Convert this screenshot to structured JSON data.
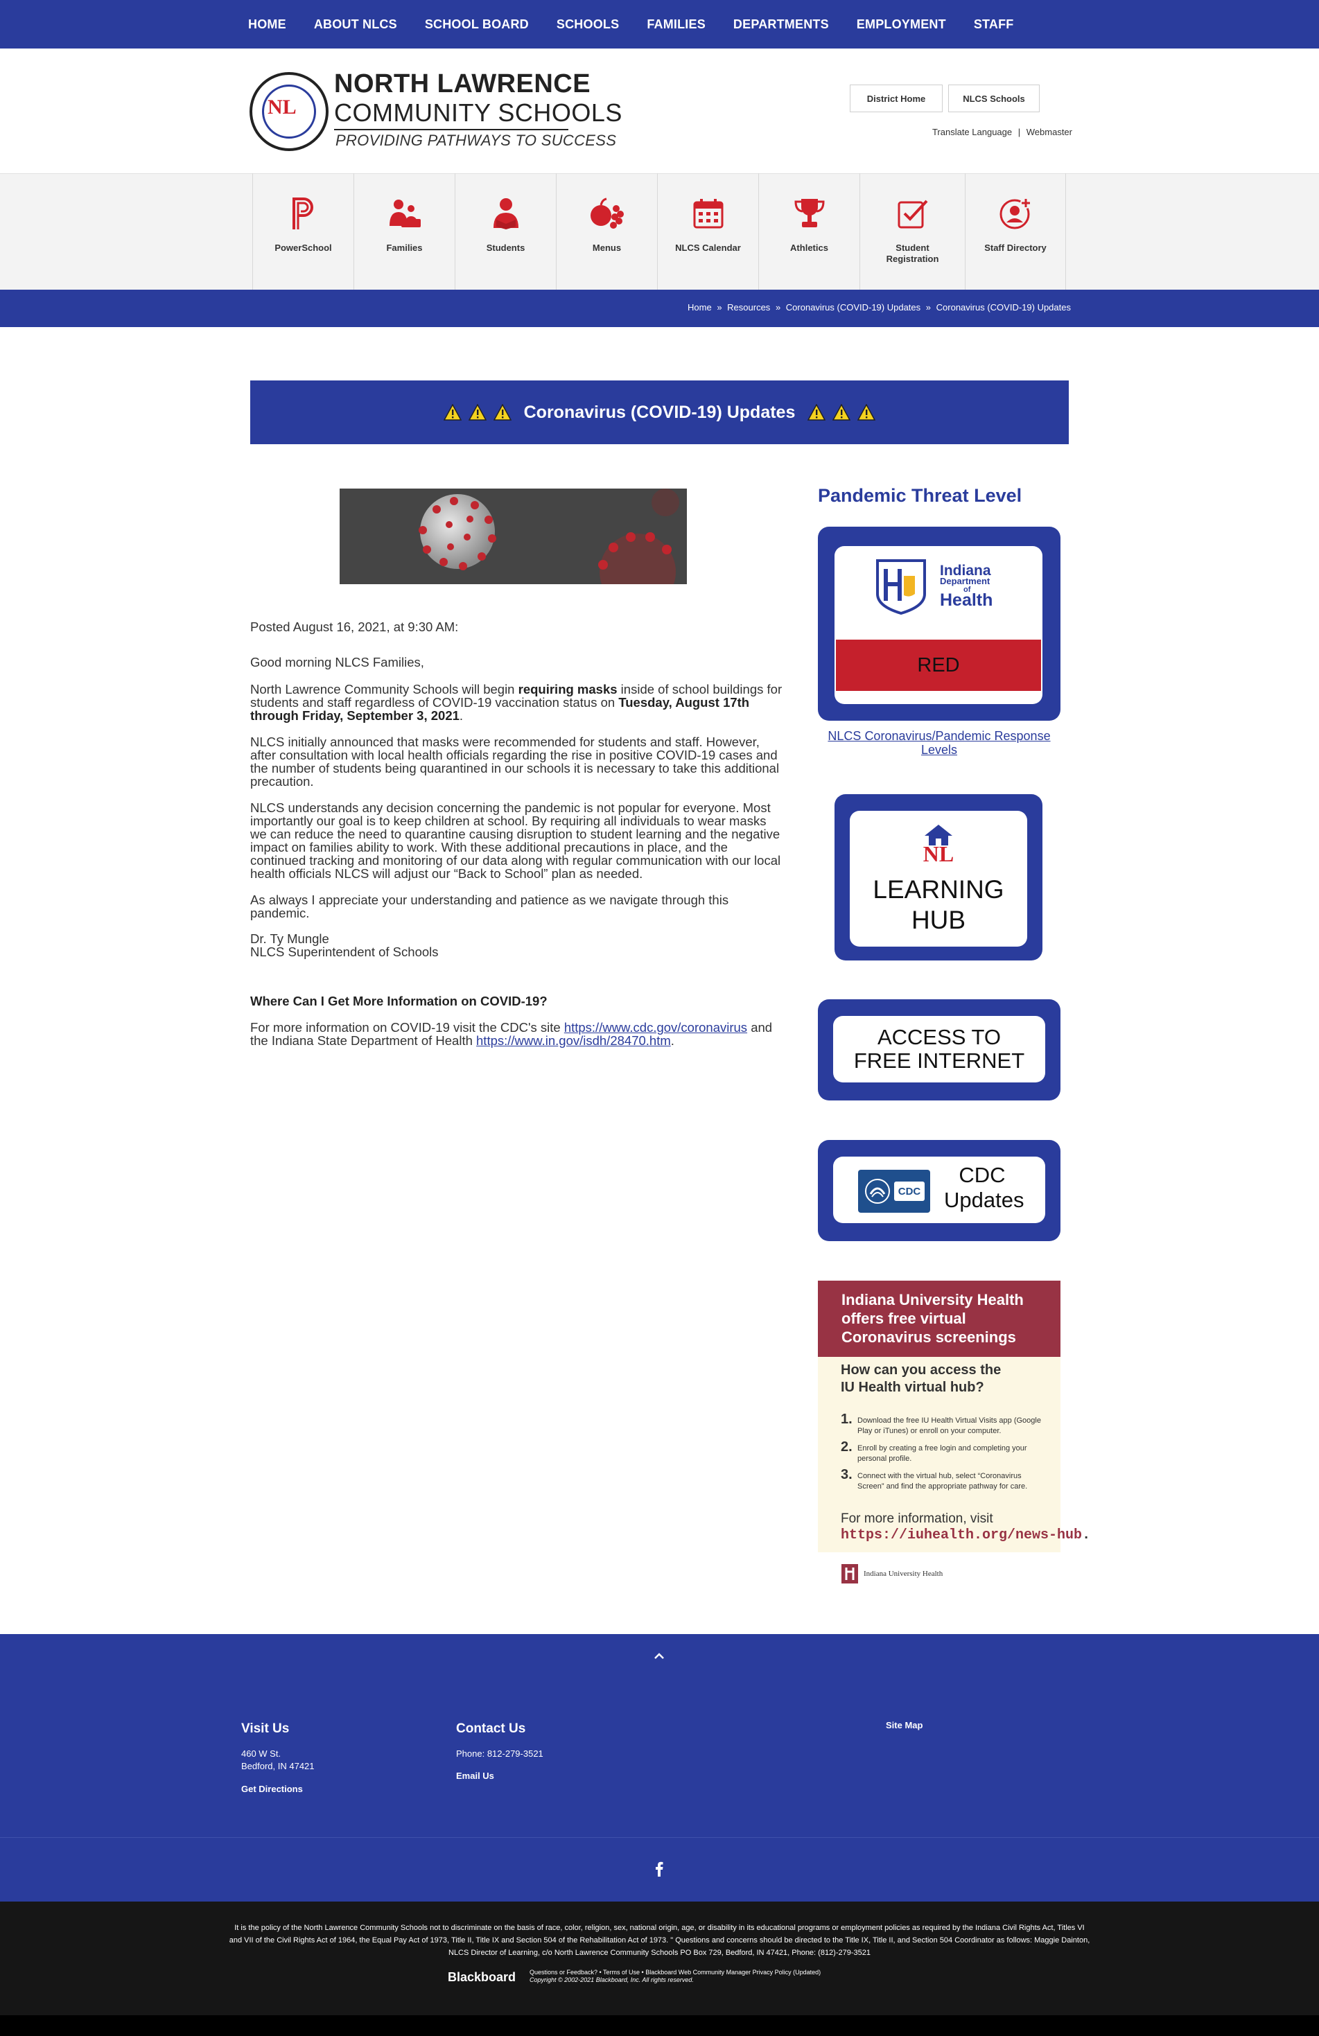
{
  "topnav": {
    "items": [
      "HOME",
      "ABOUT NLCS",
      "SCHOOL BOARD",
      "SCHOOLS",
      "FAMILIES",
      "DEPARTMENTS",
      "EMPLOYMENT",
      "STAFF"
    ]
  },
  "logo": {
    "line1": "NORTH LAWRENCE",
    "line2": "COMMUNITY SCHOOLS",
    "tagline": "PROVIDING PATHWAYS TO SUCCESS",
    "emblem_text": "NL"
  },
  "header": {
    "district_home": "District Home",
    "nlcs_schools": "NLCS Schools",
    "translate": "Translate Language",
    "separator": "|",
    "webmaster": "Webmaster"
  },
  "iconbar": {
    "items": [
      {
        "label": "PowerSchool",
        "icon": "powerschool-icon"
      },
      {
        "label": "Families",
        "icon": "families-icon"
      },
      {
        "label": "Students",
        "icon": "students-icon"
      },
      {
        "label": "Menus",
        "icon": "menus-icon"
      },
      {
        "label": "NLCS Calendar",
        "icon": "calendar-icon"
      },
      {
        "label": "Athletics",
        "icon": "trophy-icon"
      },
      {
        "label": "Student Registration",
        "icon": "registration-icon"
      },
      {
        "label": "Staff Directory",
        "icon": "staff-directory-icon"
      }
    ]
  },
  "breadcrumb": {
    "home": "Home",
    "sep": "»",
    "resources": "Resources",
    "parent": "Coronavirus (COVID-19) Updates",
    "current": "Coronavirus (COVID-19) Updates"
  },
  "title": {
    "text": "Coronavirus (COVID-19) Updates"
  },
  "article": {
    "posted": "Posted August 16, 2021, at 9:30 AM:",
    "greeting": "Good morning NLCS Families,",
    "p1_a": "North Lawrence Community Schools will begin ",
    "p1_b": "requiring masks",
    "p1_c": " inside of school buildings for students and staff regardless of COVID-19 vaccination status on ",
    "p1_d": "Tuesday, August 17th through Friday, September 3, 2021",
    "p1_e": ".",
    "p2": "NLCS initially announced that masks were recommended for students and staff.  However, after consultation with local health officials regarding the rise in positive COVID-19 cases and the number of students being quarantined in our schools it is necessary to take this additional precaution.",
    "p3": "NLCS understands any decision concerning the pandemic is not popular for everyone. Most importantly our goal is to keep children at school. By requiring all individuals to wear masks we can reduce the need to quarantine causing disruption to student learning and the negative impact on families ability to work.  With these additional precautions in place, and the continued tracking and monitoring of our data along with regular communication with our local health officials NLCS will adjust our “Back to School” plan as needed.",
    "p4": "As always I appreciate your understanding and patience as we navigate through this pandemic.",
    "sig1": "Dr. Ty Mungle",
    "sig2": "NLCS Superintendent of Schools",
    "more_heading": "Where Can I Get More Information on COVID-19?",
    "more_a": "For more information on COVID-19 visit the CDC's site ",
    "more_link1": "https://www.cdc.gov/coronavirus",
    "more_b": " and the Indiana State Department of Health ",
    "more_link2": "https://www.in.gov/isdh/28470.htm",
    "more_c": "."
  },
  "sidebar": {
    "title": "Pandemic Threat Level",
    "idh_line1": "Indiana",
    "idh_line2": "Department",
    "idh_line3": "of",
    "idh_line4": "Health",
    "threat_level": "RED",
    "threat_color": "#c5202c",
    "threat_caption": "NLCS Coronavirus/Pandemic Response Levels",
    "hub_logo": "NL",
    "hub_line1": "LEARNING",
    "hub_line2": "HUB",
    "internet_line1": "ACCESS TO",
    "internet_line2": "FREE INTERNET",
    "cdc_logo": "CDC",
    "cdc_line1": "CDC",
    "cdc_line2": "Updates"
  },
  "iu": {
    "head1": "Indiana University Health",
    "head2": "offers free virtual",
    "head3": "Coronavirus screenings",
    "q1": "How can you access the",
    "q2": "IU Health virtual hub?",
    "steps": [
      {
        "n": "1.",
        "t": "Download the free IU Health Virtual Visits app (Google Play or iTunes) or enroll on your computer."
      },
      {
        "n": "2.",
        "t": "Enroll by creating a free login and completing your personal profile."
      },
      {
        "n": "3.",
        "t": "Connect with the virtual hub, select “Coronavirus Screen” and find the appropriate pathway for care."
      }
    ],
    "more": "For more information, visit",
    "url": "https://iuhealth.org/news-hub",
    "url_dot": ".",
    "footer_logo": "Indiana University Health"
  },
  "footer": {
    "visit_heading": "Visit Us",
    "address1": "460 W St.",
    "address2": "Bedford, IN 47421",
    "directions": "Get Directions",
    "contact_heading": "Contact Us",
    "phone": "Phone: 812-279-3521",
    "email": "Email Us",
    "sitemap": "Site Map"
  },
  "bottom": {
    "disclaimer": "It is the policy of the North Lawrence Community Schools not to discriminate on the basis of race, color, religion, sex, national origin, age, or disability in its educational programs or employment policies as required by the Indiana Civil Rights Act, Titles VI and VII of the Civil Rights Act of 1964, the Equal Pay Act of 1973, Title II, Title IX and Section 504 of the Rehabilitation Act of 1973. \" Questions and concerns should be directed to the Title IX, Title II, and Section 504 Coordinator as follows: Maggie Dainton, NLCS Director of Learning, c/o North Lawrence Community Schools PO Box 729, Bedford, IN 47421, Phone: (812)-279-3521",
    "bb_logo": "Blackboard",
    "bb_links": "Questions or Feedback? • Terms of Use • Blackboard Web Community Manager Privacy Policy (Updated)",
    "bb_copy": "Copyright © 2002-2021 Blackboard, Inc. All rights reserved."
  },
  "colors": {
    "brand_blue": "#2a3c9c",
    "accent_red": "#d0222b",
    "iu_crimson": "#983344"
  }
}
